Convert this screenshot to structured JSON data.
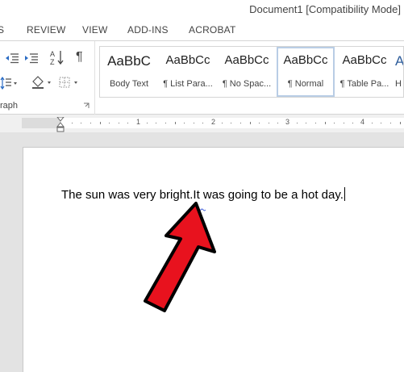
{
  "window": {
    "title": "Document1 [Compatibility Mode]"
  },
  "tabs": [
    {
      "label": "S"
    },
    {
      "label": "REVIEW"
    },
    {
      "label": "VIEW"
    },
    {
      "label": "ADD-INS"
    },
    {
      "label": "ACROBAT"
    }
  ],
  "paragraph_group": {
    "label": "raph",
    "icons": [
      "decrease-indent-icon",
      "increase-indent-icon",
      "sort-icon",
      "pilcrow-icon",
      "line-spacing-icon",
      "shading-icon",
      "borders-icon"
    ],
    "sort_glyph": "A↓Z",
    "pilcrow_glyph": "¶"
  },
  "styles": [
    {
      "sample": "AaBbC",
      "name": "Body Text"
    },
    {
      "sample": "AaBbCc",
      "name": "¶ List Para..."
    },
    {
      "sample": "AaBbCc",
      "name": "¶ No Spac..."
    },
    {
      "sample": "AaBbCc",
      "name": "¶ Normal"
    },
    {
      "sample": "AaBbCc",
      "name": "¶ Table Pa..."
    },
    {
      "sample": "A",
      "name": "H"
    }
  ],
  "ruler": {
    "numbers": [
      "1",
      "2",
      "3",
      "4"
    ]
  },
  "document": {
    "text": "The sun was very bright.It was going to be a hot day."
  },
  "colors": {
    "arrow_fill": "#e8121e",
    "arrow_outline": "#000000",
    "selected_style_border": "#b9cde5",
    "squiggle": "#3b5bdb"
  }
}
